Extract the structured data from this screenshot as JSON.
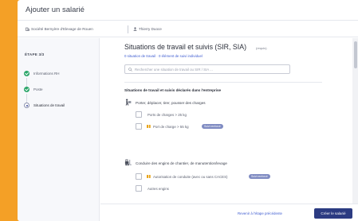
{
  "window": {
    "title": "Ajouter un salarié"
  },
  "context": {
    "company": "Société Bernyère d'Elevage de Rouen",
    "employee": "Thierry Duoce"
  },
  "sidebar": {
    "step_header": "ÉTAPE 3/3",
    "steps": [
      {
        "label": "Informations RH",
        "state": "done"
      },
      {
        "label": "Poste",
        "state": "done"
      },
      {
        "label": "Situations de travail",
        "state": "current"
      }
    ]
  },
  "main": {
    "title": "Situations de travail et suivis (SIR, SIA)",
    "title_badge": "(requis)",
    "subtitle": "0 situation de travail · 0 élément de suivi individuel",
    "search": {
      "placeholder": "Rechercher une situation de travail ou SIR / SIA ...",
      "value": ""
    },
    "group_header": "Situations de travail et suivis déclarés dans l'entreprise",
    "categories": [
      {
        "label": "Porter, déplacer, tirer, pousser des charges",
        "icon": "person-carrying-icon",
        "options": [
          {
            "label": "Ports de charges > 25 kg",
            "warning": false,
            "pill": ""
          },
          {
            "label": "Port de charge > 55 kg",
            "warning": true,
            "pill": "Suivi renforcé"
          }
        ]
      },
      {
        "label": "Conduire des engins de chantier, de manutention/levage",
        "icon": "forklift-icon",
        "options": [
          {
            "label": "Autorisation de conduite (avec ou sans CACES)",
            "warning": true,
            "pill": "Suivi renforcé"
          },
          {
            "label": "Autres engins",
            "warning": false,
            "pill": ""
          }
        ]
      }
    ]
  },
  "footer": {
    "back_label": "Revenir à l'étape précédente",
    "primary_label": "Créer le salarié"
  },
  "colors": {
    "frame": "#f4a026",
    "primary": "#2c3b82",
    "link": "#3d5bd0",
    "done": "#2ca66a",
    "warning": "#e8a317",
    "pill": "#7f8bc2"
  }
}
